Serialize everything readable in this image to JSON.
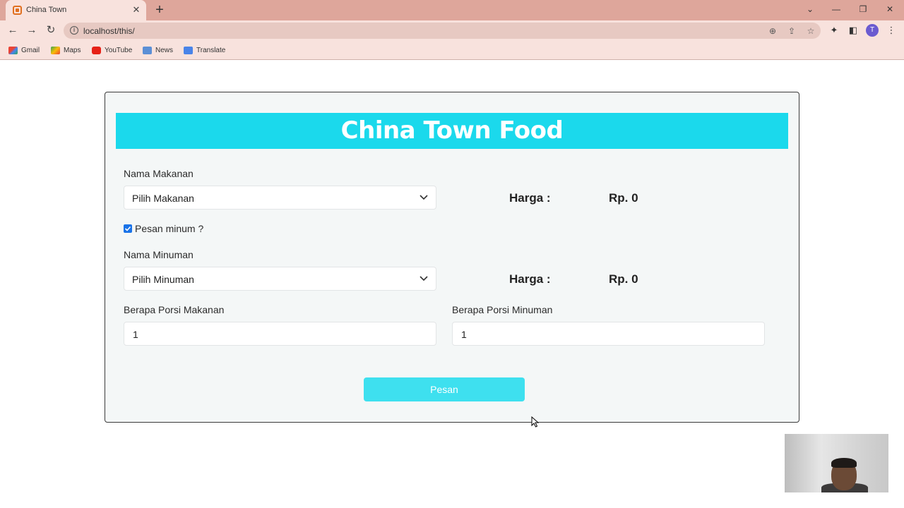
{
  "browser": {
    "tab_title": "China Town",
    "new_tab": "+",
    "url": "localhost/this/",
    "profile_initial": "T",
    "bookmarks": [
      {
        "label": "Gmail",
        "icon": "gmail-icon"
      },
      {
        "label": "Maps",
        "icon": "maps-icon"
      },
      {
        "label": "YouTube",
        "icon": "youtube-icon"
      },
      {
        "label": "News",
        "icon": "news-icon"
      },
      {
        "label": "Translate",
        "icon": "translate-icon"
      }
    ]
  },
  "page": {
    "title": "China Town Food",
    "food": {
      "label": "Nama Makanan",
      "selected": "Pilih Makanan",
      "price_label": "Harga :",
      "price_value": "Rp. 0"
    },
    "drink_checkbox": {
      "label": "Pesan minum ?",
      "checked": true
    },
    "drink": {
      "label": "Nama Minuman",
      "selected": "Pilih Minuman",
      "price_label": "Harga :",
      "price_value": "Rp. 0"
    },
    "food_portion": {
      "label": "Berapa Porsi Makanan",
      "value": "1"
    },
    "drink_portion": {
      "label": "Berapa Porsi Minuman",
      "value": "1"
    },
    "submit_label": "Pesan"
  },
  "colors": {
    "banner": "#1bd9ec",
    "button": "#3ee0ef",
    "checkbox": "#1a73e8",
    "chrome": "#dea69b"
  }
}
